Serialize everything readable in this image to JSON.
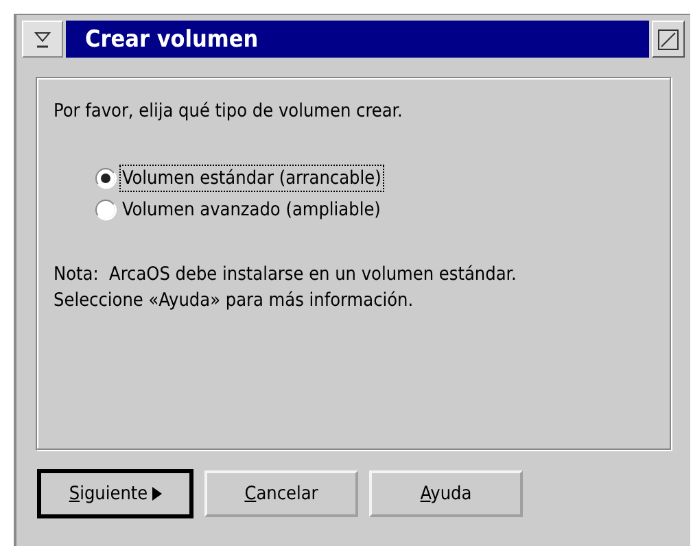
{
  "window": {
    "title": "Crear volumen"
  },
  "prompt": "Por favor, elija qué tipo de volumen crear.",
  "options": [
    {
      "label": "Volumen estándar (arrancable)",
      "selected": true,
      "focused": true
    },
    {
      "label": "Volumen avanzado (ampliable)",
      "selected": false,
      "focused": false
    }
  ],
  "note": [
    "Nota:  ArcaOS debe instalarse en un volumen estándar.",
    "Seleccione «Ayuda» para más información."
  ],
  "buttons": [
    {
      "label": "Siguiente",
      "default": true,
      "arrow": true,
      "underline_first": true
    },
    {
      "label": "Cancelar",
      "default": false,
      "arrow": false,
      "underline_first": true
    },
    {
      "label": "Ayuda",
      "default": false,
      "arrow": false,
      "underline_first": true
    }
  ]
}
